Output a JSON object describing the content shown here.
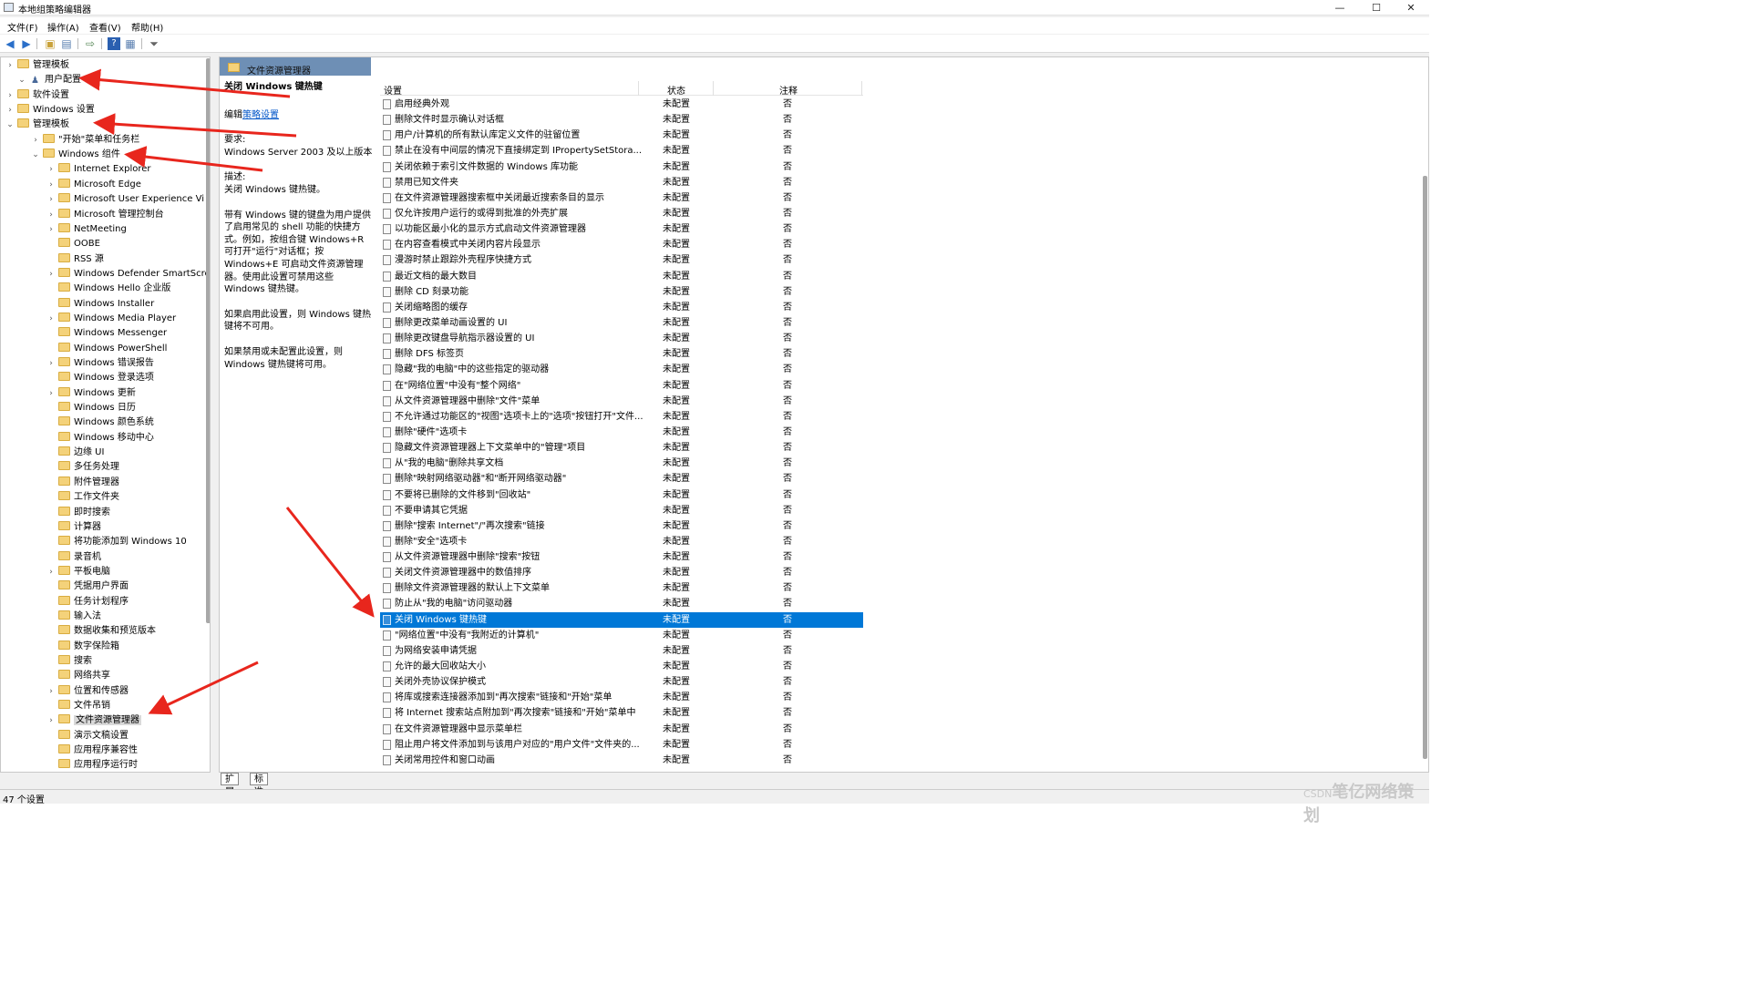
{
  "window": {
    "title": "本地组策略编辑器",
    "controls": [
      "—",
      "☐",
      "✕"
    ]
  },
  "menu": [
    "文件(F)",
    "操作(A)",
    "查看(V)",
    "帮助(H)"
  ],
  "toolbar_icons": [
    "back-arrow-icon",
    "forward-arrow-icon",
    "up-folder-icon",
    "show-hide-tree-icon",
    "export-list-icon",
    "help-icon",
    "view-icon",
    "filter-icon"
  ],
  "tree": [
    {
      "label": "管理模板",
      "level": 1,
      "chev": "›",
      "icon": "folder"
    },
    {
      "label": "用户配置",
      "level": 0,
      "chev": "⌄",
      "icon": "user"
    },
    {
      "label": "软件设置",
      "level": 1,
      "chev": "›",
      "icon": "folder"
    },
    {
      "label": "Windows 设置",
      "level": 1,
      "chev": "›",
      "icon": "folder"
    },
    {
      "label": "管理模板",
      "level": 1,
      "chev": "⌄",
      "icon": "folder"
    },
    {
      "label": "\"开始\"菜单和任务栏",
      "level": 2,
      "chev": "›",
      "icon": "folder"
    },
    {
      "label": "Windows 组件",
      "level": 2,
      "chev": "⌄",
      "icon": "folder"
    },
    {
      "label": "Internet Explorer",
      "level": 3,
      "chev": "›",
      "icon": "folder"
    },
    {
      "label": "Microsoft Edge",
      "level": 3,
      "chev": "›",
      "icon": "folder"
    },
    {
      "label": "Microsoft User Experience Vi",
      "level": 3,
      "chev": "›",
      "icon": "folder"
    },
    {
      "label": "Microsoft 管理控制台",
      "level": 3,
      "chev": "›",
      "icon": "folder"
    },
    {
      "label": "NetMeeting",
      "level": 3,
      "chev": "›",
      "icon": "folder"
    },
    {
      "label": "OOBE",
      "level": 3,
      "chev": "",
      "icon": "folder"
    },
    {
      "label": "RSS 源",
      "level": 3,
      "chev": "",
      "icon": "folder"
    },
    {
      "label": "Windows Defender SmartScre",
      "level": 3,
      "chev": "›",
      "icon": "folder"
    },
    {
      "label": "Windows Hello 企业版",
      "level": 3,
      "chev": "",
      "icon": "folder"
    },
    {
      "label": "Windows Installer",
      "level": 3,
      "chev": "",
      "icon": "folder"
    },
    {
      "label": "Windows Media Player",
      "level": 3,
      "chev": "›",
      "icon": "folder"
    },
    {
      "label": "Windows Messenger",
      "level": 3,
      "chev": "",
      "icon": "folder"
    },
    {
      "label": "Windows PowerShell",
      "level": 3,
      "chev": "",
      "icon": "folder"
    },
    {
      "label": "Windows 错误报告",
      "level": 3,
      "chev": "›",
      "icon": "folder"
    },
    {
      "label": "Windows 登录选项",
      "level": 3,
      "chev": "",
      "icon": "folder"
    },
    {
      "label": "Windows 更新",
      "level": 3,
      "chev": "›",
      "icon": "folder"
    },
    {
      "label": "Windows 日历",
      "level": 3,
      "chev": "",
      "icon": "folder"
    },
    {
      "label": "Windows 颜色系统",
      "level": 3,
      "chev": "",
      "icon": "folder"
    },
    {
      "label": "Windows 移动中心",
      "level": 3,
      "chev": "",
      "icon": "folder"
    },
    {
      "label": "边缘 UI",
      "level": 3,
      "chev": "",
      "icon": "folder"
    },
    {
      "label": "多任务处理",
      "level": 3,
      "chev": "",
      "icon": "folder"
    },
    {
      "label": "附件管理器",
      "level": 3,
      "chev": "",
      "icon": "folder"
    },
    {
      "label": "工作文件夹",
      "level": 3,
      "chev": "",
      "icon": "folder"
    },
    {
      "label": "即时搜索",
      "level": 3,
      "chev": "",
      "icon": "folder"
    },
    {
      "label": "计算器",
      "level": 3,
      "chev": "",
      "icon": "folder"
    },
    {
      "label": "将功能添加到 Windows 10",
      "level": 3,
      "chev": "",
      "icon": "folder"
    },
    {
      "label": "录音机",
      "level": 3,
      "chev": "",
      "icon": "folder"
    },
    {
      "label": "平板电脑",
      "level": 3,
      "chev": "›",
      "icon": "folder"
    },
    {
      "label": "凭据用户界面",
      "level": 3,
      "chev": "",
      "icon": "folder"
    },
    {
      "label": "任务计划程序",
      "level": 3,
      "chev": "",
      "icon": "folder"
    },
    {
      "label": "输入法",
      "level": 3,
      "chev": "",
      "icon": "folder"
    },
    {
      "label": "数据收集和预览版本",
      "level": 3,
      "chev": "",
      "icon": "folder"
    },
    {
      "label": "数字保险箱",
      "level": 3,
      "chev": "",
      "icon": "folder"
    },
    {
      "label": "搜索",
      "level": 3,
      "chev": "",
      "icon": "folder"
    },
    {
      "label": "网络共享",
      "level": 3,
      "chev": "",
      "icon": "folder"
    },
    {
      "label": "位置和传感器",
      "level": 3,
      "chev": "›",
      "icon": "folder"
    },
    {
      "label": "文件吊销",
      "level": 3,
      "chev": "",
      "icon": "folder"
    },
    {
      "label": "文件资源管理器",
      "level": 3,
      "chev": "›",
      "icon": "folder",
      "selected": true
    },
    {
      "label": "演示文稿设置",
      "level": 3,
      "chev": "",
      "icon": "folder"
    },
    {
      "label": "应用程序兼容性",
      "level": 3,
      "chev": "",
      "icon": "folder"
    },
    {
      "label": "应用程序运行时",
      "level": 3,
      "chev": "",
      "icon": "folder"
    }
  ],
  "pane_title": "文件资源管理器",
  "description": {
    "title": "关闭 Windows 键热键",
    "edit_prefix": "编辑",
    "edit_link": "策略设置",
    "req_label": "要求:",
    "req_value": "Windows Server 2003 及以上版本",
    "desc_label": "描述:",
    "desc_line": "关闭 Windows 键热键。",
    "para1": "带有 Windows 键的键盘为用户提供了启用常见的 shell 功能的快捷方式。例如，按组合键 Windows+R 可打开\"运行\"对话框；按 Windows+E 可启动文件资源管理器。使用此设置可禁用这些 Windows 键热键。",
    "para2": "如果启用此设置，则 Windows 键热键将不可用。",
    "para3": "如果禁用或未配置此设置，则 Windows 键热键将可用。"
  },
  "columns": {
    "name": "设置",
    "state": "状态",
    "note": "注释"
  },
  "settings": [
    {
      "name": "启用经典外观",
      "state": "未配置",
      "note": "否"
    },
    {
      "name": "删除文件时显示确认对话框",
      "state": "未配置",
      "note": "否"
    },
    {
      "name": "用户/计算机的所有默认库定义文件的驻留位置",
      "state": "未配置",
      "note": "否"
    },
    {
      "name": "禁止在没有中间层的情况下直接绑定到 IPropertySetStora...",
      "state": "未配置",
      "note": "否"
    },
    {
      "name": "关闭依赖于索引文件数据的 Windows 库功能",
      "state": "未配置",
      "note": "否"
    },
    {
      "name": "禁用已知文件夹",
      "state": "未配置",
      "note": "否"
    },
    {
      "name": "在文件资源管理器搜索框中关闭最近搜索条目的显示",
      "state": "未配置",
      "note": "否"
    },
    {
      "name": "仅允许按用户运行的或得到批准的外壳扩展",
      "state": "未配置",
      "note": "否"
    },
    {
      "name": "以功能区最小化的显示方式启动文件资源管理器",
      "state": "未配置",
      "note": "否"
    },
    {
      "name": "在内容查看模式中关闭内容片段显示",
      "state": "未配置",
      "note": "否"
    },
    {
      "name": "漫游时禁止跟踪外壳程序快捷方式",
      "state": "未配置",
      "note": "否"
    },
    {
      "name": "最近文档的最大数目",
      "state": "未配置",
      "note": "否"
    },
    {
      "name": "删除 CD 刻录功能",
      "state": "未配置",
      "note": "否"
    },
    {
      "name": "关闭缩略图的缓存",
      "state": "未配置",
      "note": "否"
    },
    {
      "name": "删除更改菜单动画设置的 UI",
      "state": "未配置",
      "note": "否"
    },
    {
      "name": "删除更改键盘导航指示器设置的 UI",
      "state": "未配置",
      "note": "否"
    },
    {
      "name": "删除 DFS 标签页",
      "state": "未配置",
      "note": "否"
    },
    {
      "name": "隐藏\"我的电脑\"中的这些指定的驱动器",
      "state": "未配置",
      "note": "否"
    },
    {
      "name": "在\"网络位置\"中没有\"整个网络\"",
      "state": "未配置",
      "note": "否"
    },
    {
      "name": "从文件资源管理器中删除\"文件\"菜单",
      "state": "未配置",
      "note": "否"
    },
    {
      "name": "不允许通过功能区的\"视图\"选项卡上的\"选项\"按钮打开\"文件...",
      "state": "未配置",
      "note": "否"
    },
    {
      "name": "删除\"硬件\"选项卡",
      "state": "未配置",
      "note": "否"
    },
    {
      "name": "隐藏文件资源管理器上下文菜单中的\"管理\"项目",
      "state": "未配置",
      "note": "否"
    },
    {
      "name": "从\"我的电脑\"删除共享文档",
      "state": "未配置",
      "note": "否"
    },
    {
      "name": "删除\"映射网络驱动器\"和\"断开网络驱动器\"",
      "state": "未配置",
      "note": "否"
    },
    {
      "name": "不要将已删除的文件移到\"回收站\"",
      "state": "未配置",
      "note": "否"
    },
    {
      "name": "不要申请其它凭据",
      "state": "未配置",
      "note": "否"
    },
    {
      "name": "删除\"搜索 Internet\"/\"再次搜索\"链接",
      "state": "未配置",
      "note": "否"
    },
    {
      "name": "删除\"安全\"选项卡",
      "state": "未配置",
      "note": "否"
    },
    {
      "name": "从文件资源管理器中删除\"搜索\"按钮",
      "state": "未配置",
      "note": "否"
    },
    {
      "name": "关闭文件资源管理器中的数值排序",
      "state": "未配置",
      "note": "否"
    },
    {
      "name": "删除文件资源管理器的默认上下文菜单",
      "state": "未配置",
      "note": "否"
    },
    {
      "name": "防止从\"我的电脑\"访问驱动器",
      "state": "未配置",
      "note": "否"
    },
    {
      "name": "关闭 Windows 键热键",
      "state": "未配置",
      "note": "否",
      "selected": true
    },
    {
      "name": "\"网络位置\"中没有\"我附近的计算机\"",
      "state": "未配置",
      "note": "否"
    },
    {
      "name": "为网络安装申请凭据",
      "state": "未配置",
      "note": "否"
    },
    {
      "name": "允许的最大回收站大小",
      "state": "未配置",
      "note": "否"
    },
    {
      "name": "关闭外壳协议保护模式",
      "state": "未配置",
      "note": "否"
    },
    {
      "name": "将库或搜索连接器添加到\"再次搜索\"链接和\"开始\"菜单",
      "state": "未配置",
      "note": "否"
    },
    {
      "name": "将 Internet 搜索站点附加到\"再次搜索\"链接和\"开始\"菜单中",
      "state": "未配置",
      "note": "否"
    },
    {
      "name": "在文件资源管理器中显示菜单栏",
      "state": "未配置",
      "note": "否"
    },
    {
      "name": "阻止用户将文件添加到与该用户对应的\"用户文件\"文件夹的...",
      "state": "未配置",
      "note": "否"
    },
    {
      "name": "关闭常用控件和窗口动画",
      "state": "未配置",
      "note": "否"
    }
  ],
  "tabs": [
    "扩展",
    "标准"
  ],
  "status": "47 个设置",
  "watermark": {
    "prefix": "CSDN",
    "text": "笔亿网络策划"
  },
  "colors": {
    "selection": "#0078d7",
    "pane_header": "#6e8fb5",
    "arrow": "#e8261d",
    "link": "#0054c8"
  }
}
